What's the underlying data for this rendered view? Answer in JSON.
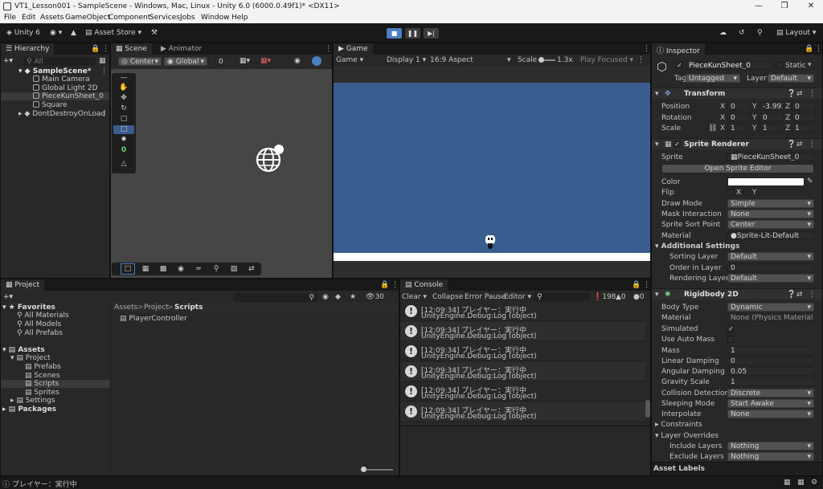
{
  "window": {
    "title": "VT1_Lesson001 - SampleScene - Windows, Mac, Linux - Unity 6.0 (6000.0.49f1)* <DX11>"
  },
  "menu": [
    "File",
    "Edit",
    "Assets",
    "GameObject",
    "Component",
    "Services",
    "Jobs",
    "Window",
    "Help"
  ],
  "toolbar": {
    "account": "Unity 6",
    "asset_store": "Asset Store",
    "layout": "Layout"
  },
  "hierarchy": {
    "tab": "Hierarchy",
    "search_placeholder": "All",
    "scene": "SampleScene*",
    "items": [
      "Main Camera",
      "Global Light 2D",
      "PieceKunSheet_0",
      "Square"
    ],
    "ddol": "DontDestroyOnLoad"
  },
  "scene": {
    "tab": "Scene",
    "tab2": "Animator",
    "pivot": "Center",
    "space": "Global",
    "snap_value": "0",
    "counter": "0"
  },
  "game": {
    "tab": "Game",
    "mode": "Game",
    "display": "Display 1",
    "aspect": "16:9 Aspect",
    "scale_label": "Scale",
    "scale_value": "1.3x",
    "play_focused": "Play Focused"
  },
  "inspector": {
    "tab": "Inspector",
    "object_name": "PieceKunSheet_0",
    "static_label": "Static",
    "tag_label": "Tag",
    "tag_value": "Untagged",
    "layer_label": "Layer",
    "layer_value": "Default",
    "transform": {
      "title": "Transform",
      "position_label": "Position",
      "rotation_label": "Rotation",
      "scale_label": "Scale",
      "position": {
        "x": "0",
        "y": "-3.993",
        "z": "0"
      },
      "rotation": {
        "x": "0",
        "y": "0",
        "z": "0"
      },
      "scale": {
        "x": "1",
        "y": "1",
        "z": "1"
      }
    },
    "sprite_renderer": {
      "title": "Sprite Renderer",
      "sprite_label": "Sprite",
      "sprite_value": "PieceKunSheet_0",
      "open_editor": "Open Sprite Editor",
      "color_label": "Color",
      "flip_label": "Flip",
      "flip_x": "X",
      "flip_y": "Y",
      "draw_mode_label": "Draw Mode",
      "draw_mode": "Simple",
      "mask_label": "Mask Interaction",
      "mask": "None",
      "sort_point_label": "Sprite Sort Point",
      "sort_point": "Center",
      "material_label": "Material",
      "material": "Sprite-Lit-Default",
      "additional": "Additional Settings",
      "sorting_layer_label": "Sorting Layer",
      "sorting_layer": "Default",
      "order_label": "Order in Layer",
      "order": "0",
      "rendering_layer_label": "Rendering Layer M",
      "rendering_layer": "Default"
    },
    "rigidbody": {
      "title": "Rigidbody 2D",
      "body_type_label": "Body Type",
      "body_type": "Dynamic",
      "material_label": "Material",
      "material": "None (Physics Material 2D)",
      "simulated_label": "Simulated",
      "full_kinematic_label": "Use Auto Mass",
      "mass_label": "Mass",
      "mass": "1",
      "linear_label": "Linear Damping",
      "linear": "0",
      "angular_label": "Angular Damping",
      "angular": "0.05",
      "gravity_label": "Gravity Scale",
      "gravity": "1",
      "collision_label": "Collision Detection",
      "collision": "Discrete",
      "sleeping_label": "Sleeping Mode",
      "sleeping": "Start Awake",
      "interpolate_label": "Interpolate",
      "interpolate": "None",
      "constraints": "Constraints",
      "layer_overrides": "Layer Overrides",
      "include_label": "Include Layers",
      "include": "Nothing",
      "exclude_label": "Exclude Layers",
      "exclude": "Nothing"
    },
    "asset_labels": "Asset Labels"
  },
  "project": {
    "tab": "Project",
    "favorites": "Favorites",
    "fav_items": [
      "All Materials",
      "All Models",
      "All Prefabs"
    ],
    "assets": "Assets",
    "project_folder": "Project",
    "subfolders": [
      "Prefabs",
      "Scenes",
      "Scripts",
      "Sprites"
    ],
    "settings": "Settings",
    "packages": "Packages",
    "breadcrumb": [
      "Assets",
      "Project",
      "Scripts"
    ],
    "files": [
      "PlayerController"
    ],
    "hidden_count": "30"
  },
  "console": {
    "tab": "Console",
    "clear": "Clear",
    "collapse": "Collapse",
    "error_pause": "Error Pause",
    "editor": "Editor",
    "log_count": "198",
    "warn_count": "0",
    "err_count": "0",
    "entries": [
      {
        "line1": "[12:09:34] プレイヤー：実行中",
        "line2": "UnityEngine.Debug:Log (object)"
      },
      {
        "line1": "[12:09:34] プレイヤー：実行中",
        "line2": "UnityEngine.Debug:Log (object)"
      },
      {
        "line1": "[12:09:34] プレイヤー：実行中",
        "line2": "UnityEngine.Debug:Log (object)"
      },
      {
        "line1": "[12:09:34] プレイヤー：実行中",
        "line2": "UnityEngine.Debug:Log (object)"
      },
      {
        "line1": "[12:09:34] プレイヤー：実行中",
        "line2": "UnityEngine.Debug:Log (object)"
      },
      {
        "line1": "[12:09:34] プレイヤー：実行中",
        "line2": "UnityEngine.Debug:Log (object)"
      }
    ]
  },
  "statusbar": {
    "message": "プレイヤー：実行中"
  },
  "colors": {
    "game_bg": "#3a5d8f",
    "scene_bg": "#464646",
    "accent": "#4a7fc0"
  }
}
